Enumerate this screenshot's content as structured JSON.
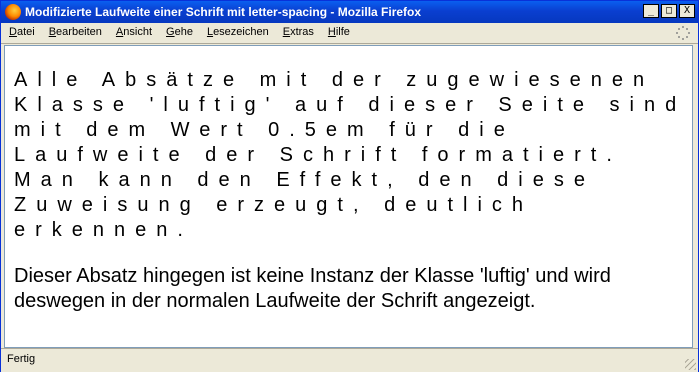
{
  "window": {
    "title": "Modifizierte Laufweite einer Schrift mit letter-spacing - Mozilla Firefox",
    "buttons": {
      "minimize": "_",
      "maximize": "□",
      "close": "X"
    }
  },
  "menubar": {
    "items": [
      {
        "first": "D",
        "rest": "atei"
      },
      {
        "first": "B",
        "rest": "earbeiten"
      },
      {
        "first": "A",
        "rest": "nsicht"
      },
      {
        "first": "G",
        "rest": "ehe"
      },
      {
        "first": "L",
        "rest": "esezeichen"
      },
      {
        "first": "E",
        "rest": "xtras"
      },
      {
        "first": "H",
        "rest": "ilfe"
      }
    ]
  },
  "content": {
    "paragraph_luftig": "Alle Absätze mit der zugewiesenen Klasse 'luftig' auf dieser Seite sind mit dem Wert 0.5em für die Laufweite der Schrift formatiert. Man kann den Effekt, den diese Zuweisung erzeugt, deutlich erkennen.",
    "paragraph_normal": "Dieser Absatz hingegen ist keine Instanz der Klasse 'luftig' und wird deswegen in der normalen Laufweite der Schrift angezeigt."
  },
  "statusbar": {
    "text": "Fertig"
  },
  "icons": {
    "app": "firefox-icon",
    "throbber": "throbber-icon",
    "grip": "resize-grip-icon"
  }
}
